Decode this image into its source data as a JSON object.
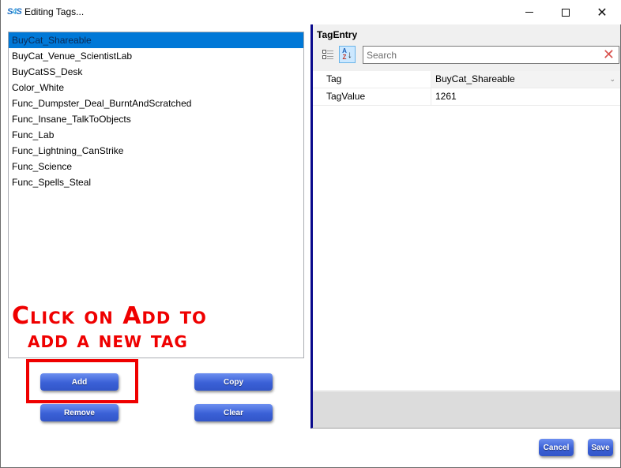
{
  "window": {
    "title": "Editing Tags...",
    "app_icon": "sims-studio-icon",
    "controls": {
      "minimize": "minimize-icon",
      "maximize": "maximize-icon",
      "close": "close-icon"
    }
  },
  "tag_list": {
    "selected_index": 0,
    "items": [
      "BuyCat_Shareable",
      "BuyCat_Venue_ScientistLab",
      "BuyCatSS_Desk",
      "Color_White",
      "Func_Dumpster_Deal_BurntAndScratched",
      "Func_Insane_TalkToObjects",
      "Func_Lab",
      "Func_Lightning_CanStrike",
      "Func_Science",
      "Func_Spells_Steal"
    ]
  },
  "annotation": {
    "line1": "Click on Add to",
    "line2": "add a new tag",
    "color": "#ef0000"
  },
  "buttons": {
    "add": "Add",
    "copy": "Copy",
    "remove": "Remove",
    "clear": "Clear",
    "cancel": "Cancel",
    "save": "Save"
  },
  "property_grid": {
    "header": "TagEntry",
    "toolbar": {
      "categorized": "categorized-view-icon",
      "alphabetical": "sort-alphabetical-icon",
      "alphabetical_active": true
    },
    "search": {
      "placeholder": "Search",
      "value": ""
    },
    "rows": [
      {
        "name": "Tag",
        "value": "BuyCat_Shareable",
        "has_dropdown": true
      },
      {
        "name": "TagValue",
        "value": "1261",
        "has_dropdown": false
      }
    ]
  },
  "colors": {
    "selection": "#0078d7",
    "button": "#3a60d6",
    "panel_accent": "#0a0a8c"
  }
}
